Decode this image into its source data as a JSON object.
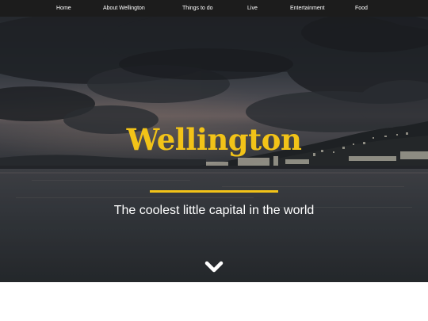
{
  "nav": {
    "items": [
      {
        "label": "Home"
      },
      {
        "label": "About Wellington"
      },
      {
        "label": "Things to do"
      },
      {
        "label": "Live"
      },
      {
        "label": "Entertainment"
      },
      {
        "label": "Food"
      }
    ]
  },
  "hero": {
    "title": "Wellington",
    "subtitle": "The coolest little capital in the world",
    "scroll_icon": "chevron-down-icon"
  },
  "colors": {
    "navbar": "#1c1c1c",
    "accent": "#f2c318",
    "text": "#ffffff"
  }
}
